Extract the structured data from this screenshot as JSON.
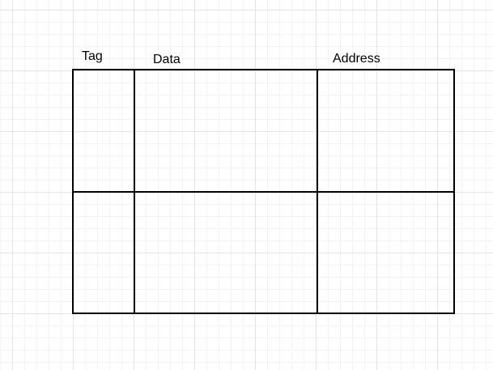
{
  "columns": [
    {
      "label": "Tag"
    },
    {
      "label": "Data"
    },
    {
      "label": "Address"
    }
  ],
  "rows": 2,
  "colors": {
    "background": "#ffffff",
    "grid_major": "#e4e4e4",
    "grid_minor": "#f3f3f3",
    "stroke": "#000000",
    "text": "#000000"
  }
}
